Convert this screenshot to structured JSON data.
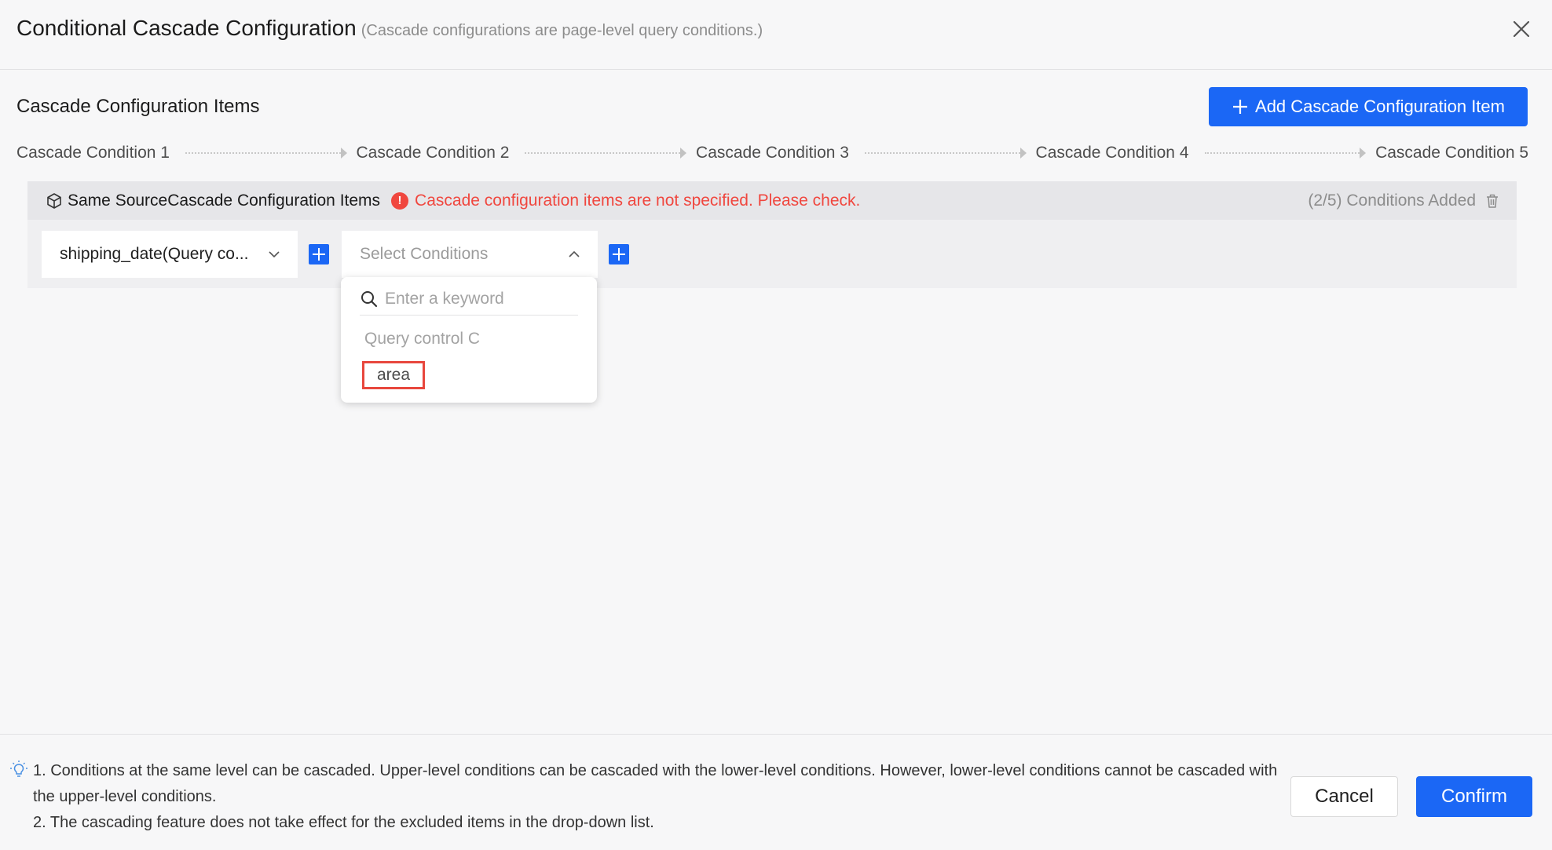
{
  "dialog": {
    "title": "Conditional Cascade Configuration",
    "title_hint": "(Cascade configurations are page-level query conditions.)"
  },
  "section": {
    "title": "Cascade Configuration Items",
    "add_button_label": "Add Cascade Configuration Item"
  },
  "steps": [
    "Cascade Condition 1",
    "Cascade Condition 2",
    "Cascade Condition 3",
    "Cascade Condition 4",
    "Cascade Condition 5"
  ],
  "group": {
    "label": "Same SourceCascade Configuration Items",
    "warning": "Cascade configuration items are not specified. Please check.",
    "count": "(2/5) Conditions Added"
  },
  "condition_1": {
    "value": "shipping_date(Query co..."
  },
  "condition_2": {
    "placeholder": "Select Conditions"
  },
  "dropdown": {
    "search_placeholder": "Enter a keyword",
    "group_label": "Query control C",
    "options": [
      "area"
    ]
  },
  "footer": {
    "note_1": "1. Conditions at the same level can be cascaded. Upper-level conditions can be cascaded with the lower-level conditions. However, lower-level conditions cannot be cascaded with the upper-level conditions.",
    "note_2": "2. The cascading feature does not take effect for the excluded items in the drop-down list.",
    "cancel_label": "Cancel",
    "confirm_label": "Confirm"
  },
  "colors": {
    "accent": "#1b67f5",
    "error": "#f0473f",
    "highlight_box": "#e8473d"
  }
}
